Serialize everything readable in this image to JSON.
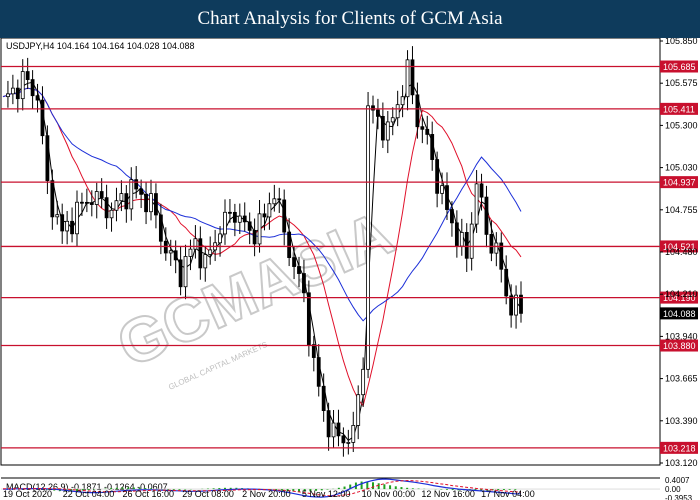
{
  "header": {
    "title": "Chart Analysis for Clients of GCM Asia"
  },
  "watermark": {
    "text": "GCMASIA",
    "sub": "GLOBAL CAPITAL MARKETS"
  },
  "chart_data": [
    {
      "type": "line",
      "symbol_info": "USDJPY,H4  104.164 104.164 104.028 104.088",
      "series_style": "candlestick",
      "x_tick_labels": [
        "19 Oct 2020",
        "22 Oct 04:00",
        "26 Oct 16:00",
        "29 Oct 08:00",
        "2 Nov 20:00",
        "5 Nov 12:00",
        "10 Nov 00:00",
        "12 Nov 16:00",
        "17 Nov 04:00"
      ],
      "y_tick_labels": [
        "105.850",
        "105.575",
        "105.300",
        "105.030",
        "104.755",
        "104.480",
        "104.210",
        "103.940",
        "103.665",
        "103.390",
        "103.120"
      ],
      "ylim": [
        103.12,
        105.85
      ],
      "current_price": "104.088",
      "levels": [
        {
          "label": "105.685",
          "value": 105.685
        },
        {
          "label": "105.411",
          "value": 105.411
        },
        {
          "label": "104.937",
          "value": 104.937
        },
        {
          "label": "104.521",
          "value": 104.521
        },
        {
          "label": "104.190",
          "value": 104.19
        },
        {
          "label": "103.880",
          "value": 103.88
        },
        {
          "label": "103.218",
          "value": 103.218
        }
      ],
      "close_path": [
        [
          0,
          105.45
        ],
        [
          4,
          105.6
        ],
        [
          7,
          105.5
        ],
        [
          9,
          104.9
        ],
        [
          12,
          104.6
        ],
        [
          15,
          104.75
        ],
        [
          18,
          104.85
        ],
        [
          22,
          104.75
        ],
        [
          26,
          104.9
        ],
        [
          30,
          104.8
        ],
        [
          33,
          104.5
        ],
        [
          36,
          104.35
        ],
        [
          39,
          104.55
        ],
        [
          41,
          104.4
        ],
        [
          44,
          104.65
        ],
        [
          47,
          104.75
        ],
        [
          50,
          104.6
        ],
        [
          53,
          104.7
        ],
        [
          55,
          104.9
        ],
        [
          57,
          104.6
        ],
        [
          59,
          104.4
        ],
        [
          61,
          104.2
        ],
        [
          63,
          103.75
        ],
        [
          65,
          103.45
        ],
        [
          67,
          103.3
        ],
        [
          69,
          103.28
        ],
        [
          71,
          103.3
        ],
        [
          73,
          103.8
        ],
        [
          74,
          105.4
        ],
        [
          76,
          105.35
        ],
        [
          78,
          105.25
        ],
        [
          80,
          105.45
        ],
        [
          82,
          105.65
        ],
        [
          84,
          105.35
        ],
        [
          86,
          105.2
        ],
        [
          88,
          104.95
        ],
        [
          90,
          104.75
        ],
        [
          92,
          104.6
        ],
        [
          94,
          104.45
        ],
        [
          96,
          104.95
        ],
        [
          98,
          104.6
        ],
        [
          100,
          104.5
        ],
        [
          102,
          104.2
        ],
        [
          104,
          104.12
        ],
        [
          105,
          104.088
        ]
      ],
      "moving_average_colors": [
        "#000000",
        "#e0102a",
        "#1c2fd8"
      ],
      "level_color": "#c8102e"
    },
    {
      "type": "bar",
      "label": "MACD(12,26,9) -0.1871 -0.1264 -0.0607",
      "y_tick_labels": [
        "0.4007",
        "0.00",
        "-0.3953"
      ],
      "ylim": [
        -0.3953,
        0.4007
      ],
      "histogram": [
        0.01,
        0.02,
        0.02,
        0.03,
        0.03,
        0.02,
        0.0,
        -0.03,
        -0.06,
        -0.08,
        -0.09,
        -0.09,
        -0.08,
        -0.06,
        -0.04,
        -0.02,
        0.0,
        0.02,
        0.04,
        0.05,
        0.06,
        0.06,
        0.06,
        0.05,
        0.04,
        0.03,
        0.01,
        -0.01,
        -0.02,
        -0.03,
        -0.03,
        -0.02,
        -0.01,
        0.0,
        0.01,
        0.02,
        0.03,
        0.04,
        0.05,
        0.05,
        0.05,
        0.04,
        0.03,
        0.02,
        0.01,
        0.0,
        -0.02,
        -0.04,
        -0.06,
        -0.08,
        -0.09,
        -0.1,
        -0.1,
        -0.09,
        -0.07,
        -0.05,
        -0.02,
        0.01,
        0.05,
        0.1,
        0.18,
        0.26,
        0.3,
        0.3,
        0.27,
        0.23,
        0.19,
        0.15,
        0.11,
        0.08,
        0.05,
        0.03,
        0.02,
        0.01,
        0.0,
        -0.01,
        -0.02,
        -0.03,
        -0.04,
        -0.05,
        -0.05,
        -0.06,
        -0.06,
        -0.06,
        -0.05,
        -0.05,
        -0.04,
        -0.04,
        -0.03,
        -0.03
      ],
      "macd_line": [
        0.0,
        0.0,
        0.01,
        0.01,
        0.02,
        0.02,
        0.02,
        0.01,
        0.0,
        -0.02,
        -0.05,
        -0.08,
        -0.11,
        -0.13,
        -0.14,
        -0.14,
        -0.13,
        -0.11,
        -0.09,
        -0.07,
        -0.05,
        -0.04,
        -0.03,
        -0.03,
        -0.03,
        -0.04,
        -0.05,
        -0.06,
        -0.07,
        -0.08,
        -0.09,
        -0.09,
        -0.08,
        -0.07,
        -0.05,
        -0.03,
        -0.02,
        -0.01,
        0.0,
        0.0,
        0.0,
        -0.01,
        -0.02,
        -0.04,
        -0.07,
        -0.11,
        -0.15,
        -0.2,
        -0.25,
        -0.29,
        -0.31,
        -0.32,
        -0.3,
        -0.25,
        -0.17,
        -0.06,
        0.06,
        0.17,
        0.26,
        0.33,
        0.38,
        0.4,
        0.39,
        0.36,
        0.33,
        0.3,
        0.27,
        0.23,
        0.19,
        0.14,
        0.1,
        0.06,
        0.03,
        0.0,
        -0.02,
        -0.04,
        -0.06,
        -0.08,
        -0.1,
        -0.12,
        -0.14,
        -0.16,
        -0.19,
        -0.19
      ],
      "signal_line": [
        0.01,
        0.01,
        0.01,
        0.01,
        0.01,
        0.02,
        0.02,
        0.02,
        0.02,
        0.01,
        0.0,
        -0.02,
        -0.04,
        -0.06,
        -0.08,
        -0.1,
        -0.11,
        -0.11,
        -0.11,
        -0.1,
        -0.09,
        -0.08,
        -0.07,
        -0.06,
        -0.05,
        -0.05,
        -0.05,
        -0.05,
        -0.06,
        -0.06,
        -0.07,
        -0.07,
        -0.07,
        -0.07,
        -0.06,
        -0.06,
        -0.05,
        -0.04,
        -0.03,
        -0.03,
        -0.02,
        -0.02,
        -0.02,
        -0.03,
        -0.04,
        -0.05,
        -0.07,
        -0.1,
        -0.13,
        -0.17,
        -0.21,
        -0.24,
        -0.26,
        -0.27,
        -0.26,
        -0.23,
        -0.18,
        -0.11,
        -0.03,
        0.06,
        0.14,
        0.21,
        0.27,
        0.31,
        0.33,
        0.34,
        0.33,
        0.31,
        0.28,
        0.25,
        0.21,
        0.18,
        0.14,
        0.11,
        0.08,
        0.05,
        0.02,
        0.0,
        -0.02,
        -0.05,
        -0.07,
        -0.09,
        -0.11,
        -0.13
      ],
      "colors": {
        "histogram": "#1fa01f",
        "macd": "#1c2fd8",
        "signal": "#e0102a"
      }
    }
  ]
}
